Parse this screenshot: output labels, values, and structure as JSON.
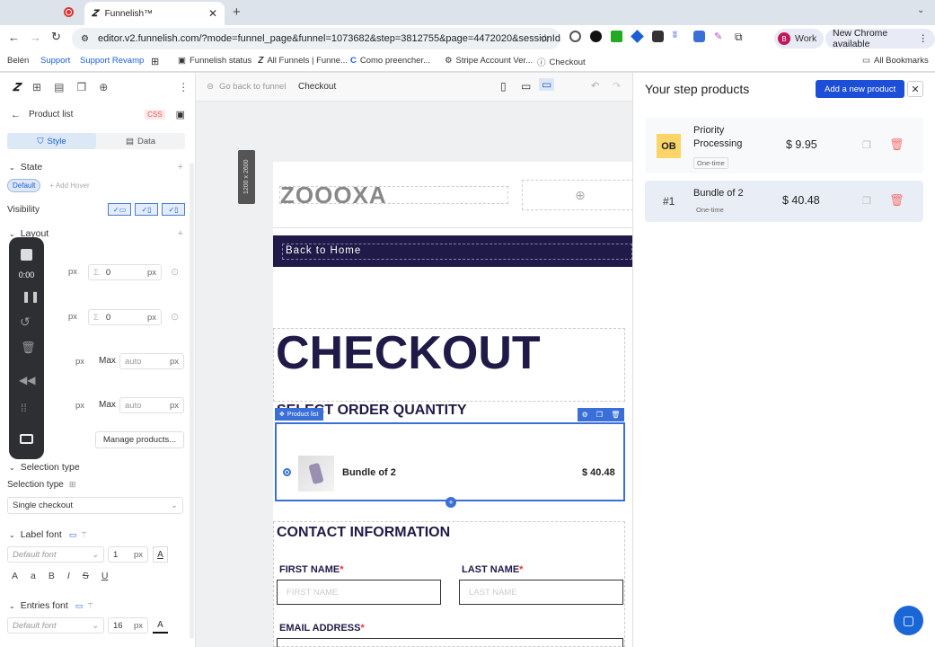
{
  "browser": {
    "tab_title": "Funnelish™",
    "url": "editor.v2.funnelish.com/?mode=funnel_page&funnel=1073682&step=3812755&page=4472020&sessionId=...",
    "profile_label": "Work",
    "profile_initial": "B",
    "update_label": "New Chrome available",
    "bookmarks": [
      "Belén",
      "Support",
      "Support Revamp",
      "Funnelish status",
      "All Funnels | Funne...",
      "Como preencher...",
      "Stripe Account Ver...",
      "Checkout"
    ],
    "all_bookmarks": "All Bookmarks"
  },
  "editor": {
    "back_label": "Go back to funnel",
    "page_name": "Checkout",
    "size_label": "1200 x 2600"
  },
  "panel": {
    "title": "Product list",
    "css_label": "CSS",
    "tab_style": "Style",
    "tab_data": "Data",
    "state_heading": "State",
    "state_default": "Default",
    "add_hover": "+ Add Hover",
    "visibility": "Visibility",
    "layout": "Layout",
    "zero1": "0",
    "zero2": "0",
    "px": "px",
    "max": "Max",
    "auto": "auto",
    "manage_products": "Manage products...",
    "selection_type_heading": "Selection type",
    "selection_type_label": "Selection type",
    "selection_type_value": "Single checkout",
    "label_font": "Label font",
    "entries_font": "Entries font",
    "default_font": "Default font",
    "label_font_size": "1",
    "entries_font_size": "16"
  },
  "recorder": {
    "time": "0:00"
  },
  "page": {
    "logo": "ZOOOXA",
    "back_home": "Back to Home",
    "checkout_title": "CHECKOUT",
    "select_qty": "SELECT ORDER QUANTITY",
    "product_list_tag": "Product list",
    "product_name": "Bundle of 2",
    "product_price": "$ 40.48",
    "contact_info": "CONTACT INFORMATION",
    "first_name_label": "FIRST NAME",
    "first_name_ph": "FIRST NAME",
    "last_name_label": "LAST NAME",
    "last_name_ph": "LAST NAME",
    "email_label": "EMAIL ADDRESS",
    "required": "*"
  },
  "step_products": {
    "title": "Your step products",
    "add_button": "Add a new product",
    "items": [
      {
        "badge": "OB",
        "name": "Priority Processing",
        "price": "$ 9.95",
        "billing": "One-time"
      },
      {
        "badge": "#1",
        "name": "Bundle of 2",
        "price": "$ 40.48",
        "billing": "One-time"
      }
    ]
  },
  "colors": {
    "accent": "#1d4ed8",
    "dark_nav": "#1f1a47",
    "ob_badge": "#fcd569",
    "delete": "#f87171"
  }
}
